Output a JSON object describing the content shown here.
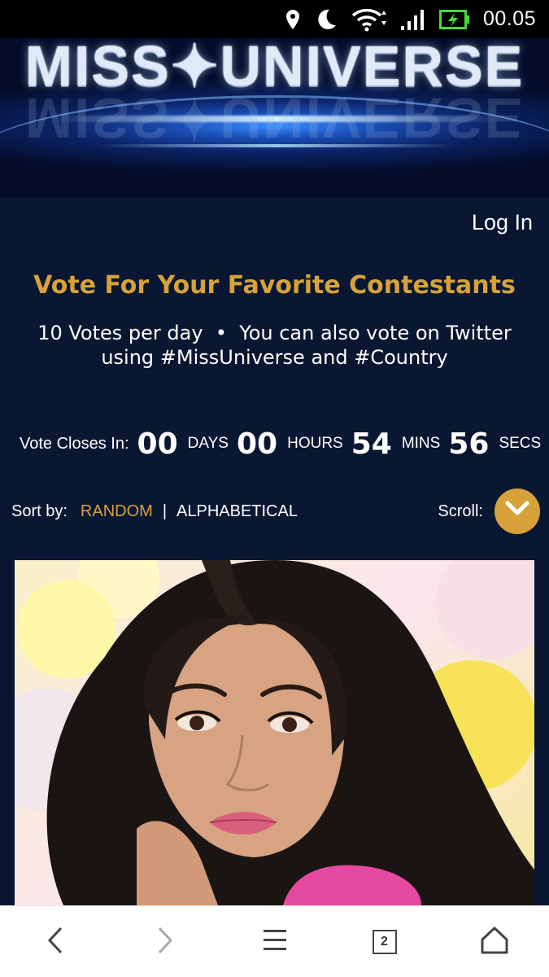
{
  "status_bar": {
    "time": "00.05",
    "icons": [
      "location-icon",
      "moon-icon",
      "wifi-icon",
      "signal-icon",
      "battery-charging-icon"
    ],
    "battery_color": "#44dd33"
  },
  "banner": {
    "logo_text": "MISS✦UNIVERSE"
  },
  "header": {
    "login_label": "Log In"
  },
  "vote": {
    "headline": "Vote For Your Favorite Contestants",
    "subline_1": "10 Votes per day  •  You can also vote on Twitter",
    "subline_2": "using #MissUniverse and #Country"
  },
  "countdown": {
    "label": "Vote Closes In:",
    "days": "00",
    "days_unit": "DAYS",
    "hours": "00",
    "hours_unit": "HOURS",
    "mins": "54",
    "mins_unit": "MINS",
    "secs": "56",
    "secs_unit": "SECS"
  },
  "sort": {
    "label": "Sort by:",
    "random": "RANDOM",
    "separator": "|",
    "alphabetical": "ALPHABETICAL",
    "scroll_label": "Scroll:"
  },
  "browser_bar": {
    "tab_count": "2",
    "icons": [
      "back-arrow-icon",
      "forward-arrow-icon",
      "menu-icon",
      "tabs-icon",
      "home-icon"
    ]
  },
  "colors": {
    "accent_gold": "#d7a23a",
    "page_bg": "#0a1733"
  }
}
